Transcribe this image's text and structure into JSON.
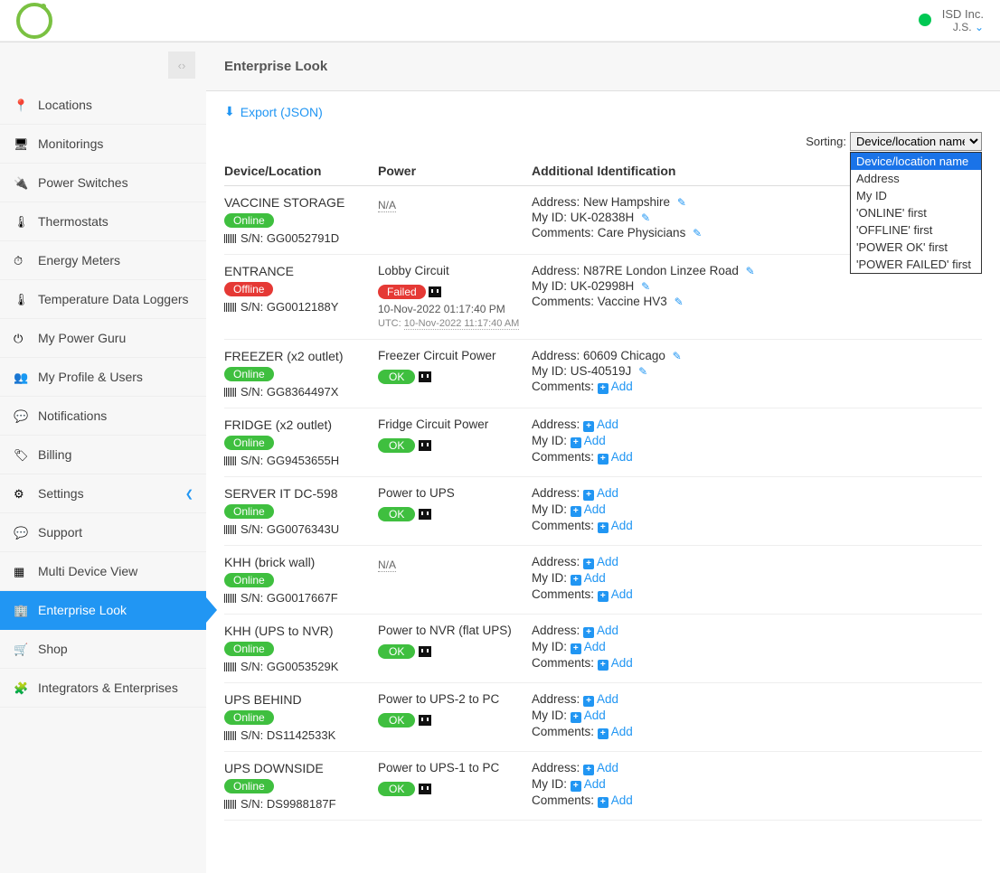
{
  "header": {
    "company": "ISD Inc.",
    "user": "J.S."
  },
  "page": {
    "title": "Enterprise Look",
    "export_label": "Export (JSON)"
  },
  "sidebar": {
    "items": [
      {
        "label": "Locations",
        "icon": "pin",
        "active": false,
        "has_submenu": false
      },
      {
        "label": "Monitorings",
        "icon": "monitor",
        "active": false,
        "has_submenu": false
      },
      {
        "label": "Power Switches",
        "icon": "plug",
        "active": false,
        "has_submenu": false
      },
      {
        "label": "Thermostats",
        "icon": "thermo",
        "active": false,
        "has_submenu": false
      },
      {
        "label": "Energy Meters",
        "icon": "gauge",
        "active": false,
        "has_submenu": false
      },
      {
        "label": "Temperature Data Loggers",
        "icon": "temp",
        "active": false,
        "has_submenu": false
      },
      {
        "label": "My Power Guru",
        "icon": "power",
        "active": false,
        "has_submenu": false
      },
      {
        "label": "My Profile & Users",
        "icon": "users",
        "active": false,
        "has_submenu": false
      },
      {
        "label": "Notifications",
        "icon": "bell",
        "active": false,
        "has_submenu": false
      },
      {
        "label": "Billing",
        "icon": "tag",
        "active": false,
        "has_submenu": false
      },
      {
        "label": "Settings",
        "icon": "gear",
        "active": false,
        "has_submenu": true
      },
      {
        "label": "Support",
        "icon": "chat",
        "active": false,
        "has_submenu": false
      },
      {
        "label": "Multi Device View",
        "icon": "grid",
        "active": false,
        "has_submenu": false
      },
      {
        "label": "Enterprise Look",
        "icon": "building",
        "active": true,
        "has_submenu": false
      },
      {
        "label": "Shop",
        "icon": "cart",
        "active": false,
        "has_submenu": false
      },
      {
        "label": "Integrators & Enterprises",
        "icon": "puzzle",
        "active": false,
        "has_submenu": false
      }
    ]
  },
  "sorting": {
    "label": "Sorting:",
    "selected": "Device/location name",
    "options": [
      "Device/location name",
      "Address",
      "My ID",
      "'ONLINE' first",
      "'OFFLINE' first",
      "'POWER OK' first",
      "'POWER FAILED' first"
    ]
  },
  "columns": {
    "device": "Device/Location",
    "power": "Power",
    "addl": "Additional Identification"
  },
  "labels": {
    "sn": "S/N:",
    "address": "Address:",
    "myid": "My ID:",
    "comments": "Comments:",
    "add": "Add",
    "utc": "UTC:"
  },
  "rows": [
    {
      "name": "VACCINE STORAGE",
      "outlet": "",
      "status": "Online",
      "sn": "GG0052791D",
      "power_name": "",
      "power_status": "N/A",
      "timestamp": "",
      "utc": "",
      "address": "New Hampshire",
      "myid": "UK-02838H",
      "comments": "Care Physicians",
      "address_edit": true,
      "myid_edit": true,
      "comments_edit": true
    },
    {
      "name": "ENTRANCE",
      "outlet": "",
      "status": "Offline",
      "sn": "GG0012188Y",
      "power_name": "Lobby Circuit",
      "power_status": "Failed",
      "timestamp": "10-Nov-2022 01:17:40 PM",
      "utc": "10-Nov-2022 11:17:40 AM",
      "address": "N87RE London Linzee Road",
      "myid": "UK-02998H",
      "comments": "Vaccine HV3",
      "address_edit": true,
      "myid_edit": true,
      "comments_edit": true
    },
    {
      "name": "FREEZER",
      "outlet": "(x2 outlet)",
      "status": "Online",
      "sn": "GG8364497X",
      "power_name": "Freezer Circuit Power",
      "power_status": "OK",
      "timestamp": "",
      "utc": "",
      "address": "60609 Chicago",
      "myid": "US-40519J",
      "comments": "",
      "address_edit": true,
      "myid_edit": true,
      "comments_edit": false
    },
    {
      "name": "FRIDGE",
      "outlet": "(x2 outlet)",
      "status": "Online",
      "sn": "GG9453655H",
      "power_name": "Fridge Circuit Power",
      "power_status": "OK",
      "timestamp": "",
      "utc": "",
      "address": "",
      "myid": "",
      "comments": "",
      "address_edit": false,
      "myid_edit": false,
      "comments_edit": false
    },
    {
      "name": "SERVER IT DC-598",
      "outlet": "",
      "status": "Online",
      "sn": "GG0076343U",
      "power_name": "Power to UPS",
      "power_status": "OK",
      "timestamp": "",
      "utc": "",
      "address": "",
      "myid": "",
      "comments": "",
      "address_edit": false,
      "myid_edit": false,
      "comments_edit": false
    },
    {
      "name": "KHH",
      "outlet": "(brick wall)",
      "status": "Online",
      "sn": "GG0017667F",
      "power_name": "",
      "power_status": "N/A",
      "timestamp": "",
      "utc": "",
      "address": "",
      "myid": "",
      "comments": "",
      "address_edit": false,
      "myid_edit": false,
      "comments_edit": false
    },
    {
      "name": "KHH",
      "outlet": "(UPS to NVR)",
      "status": "Online",
      "sn": "GG0053529K",
      "power_name": "Power to NVR (flat UPS)",
      "power_status": "OK",
      "timestamp": "",
      "utc": "",
      "address": "",
      "myid": "",
      "comments": "",
      "address_edit": false,
      "myid_edit": false,
      "comments_edit": false
    },
    {
      "name": "UPS BEHIND",
      "outlet": "",
      "status": "Online",
      "sn": "DS1142533K",
      "power_name": "Power to UPS-2 to PC",
      "power_status": "OK",
      "timestamp": "",
      "utc": "",
      "address": "",
      "myid": "",
      "comments": "",
      "address_edit": false,
      "myid_edit": false,
      "comments_edit": false
    },
    {
      "name": "UPS DOWNSIDE",
      "outlet": "",
      "status": "Online",
      "sn": "DS9988187F",
      "power_name": "Power to UPS-1 to PC",
      "power_status": "OK",
      "timestamp": "",
      "utc": "",
      "address": "",
      "myid": "",
      "comments": "",
      "address_edit": false,
      "myid_edit": false,
      "comments_edit": false
    }
  ]
}
